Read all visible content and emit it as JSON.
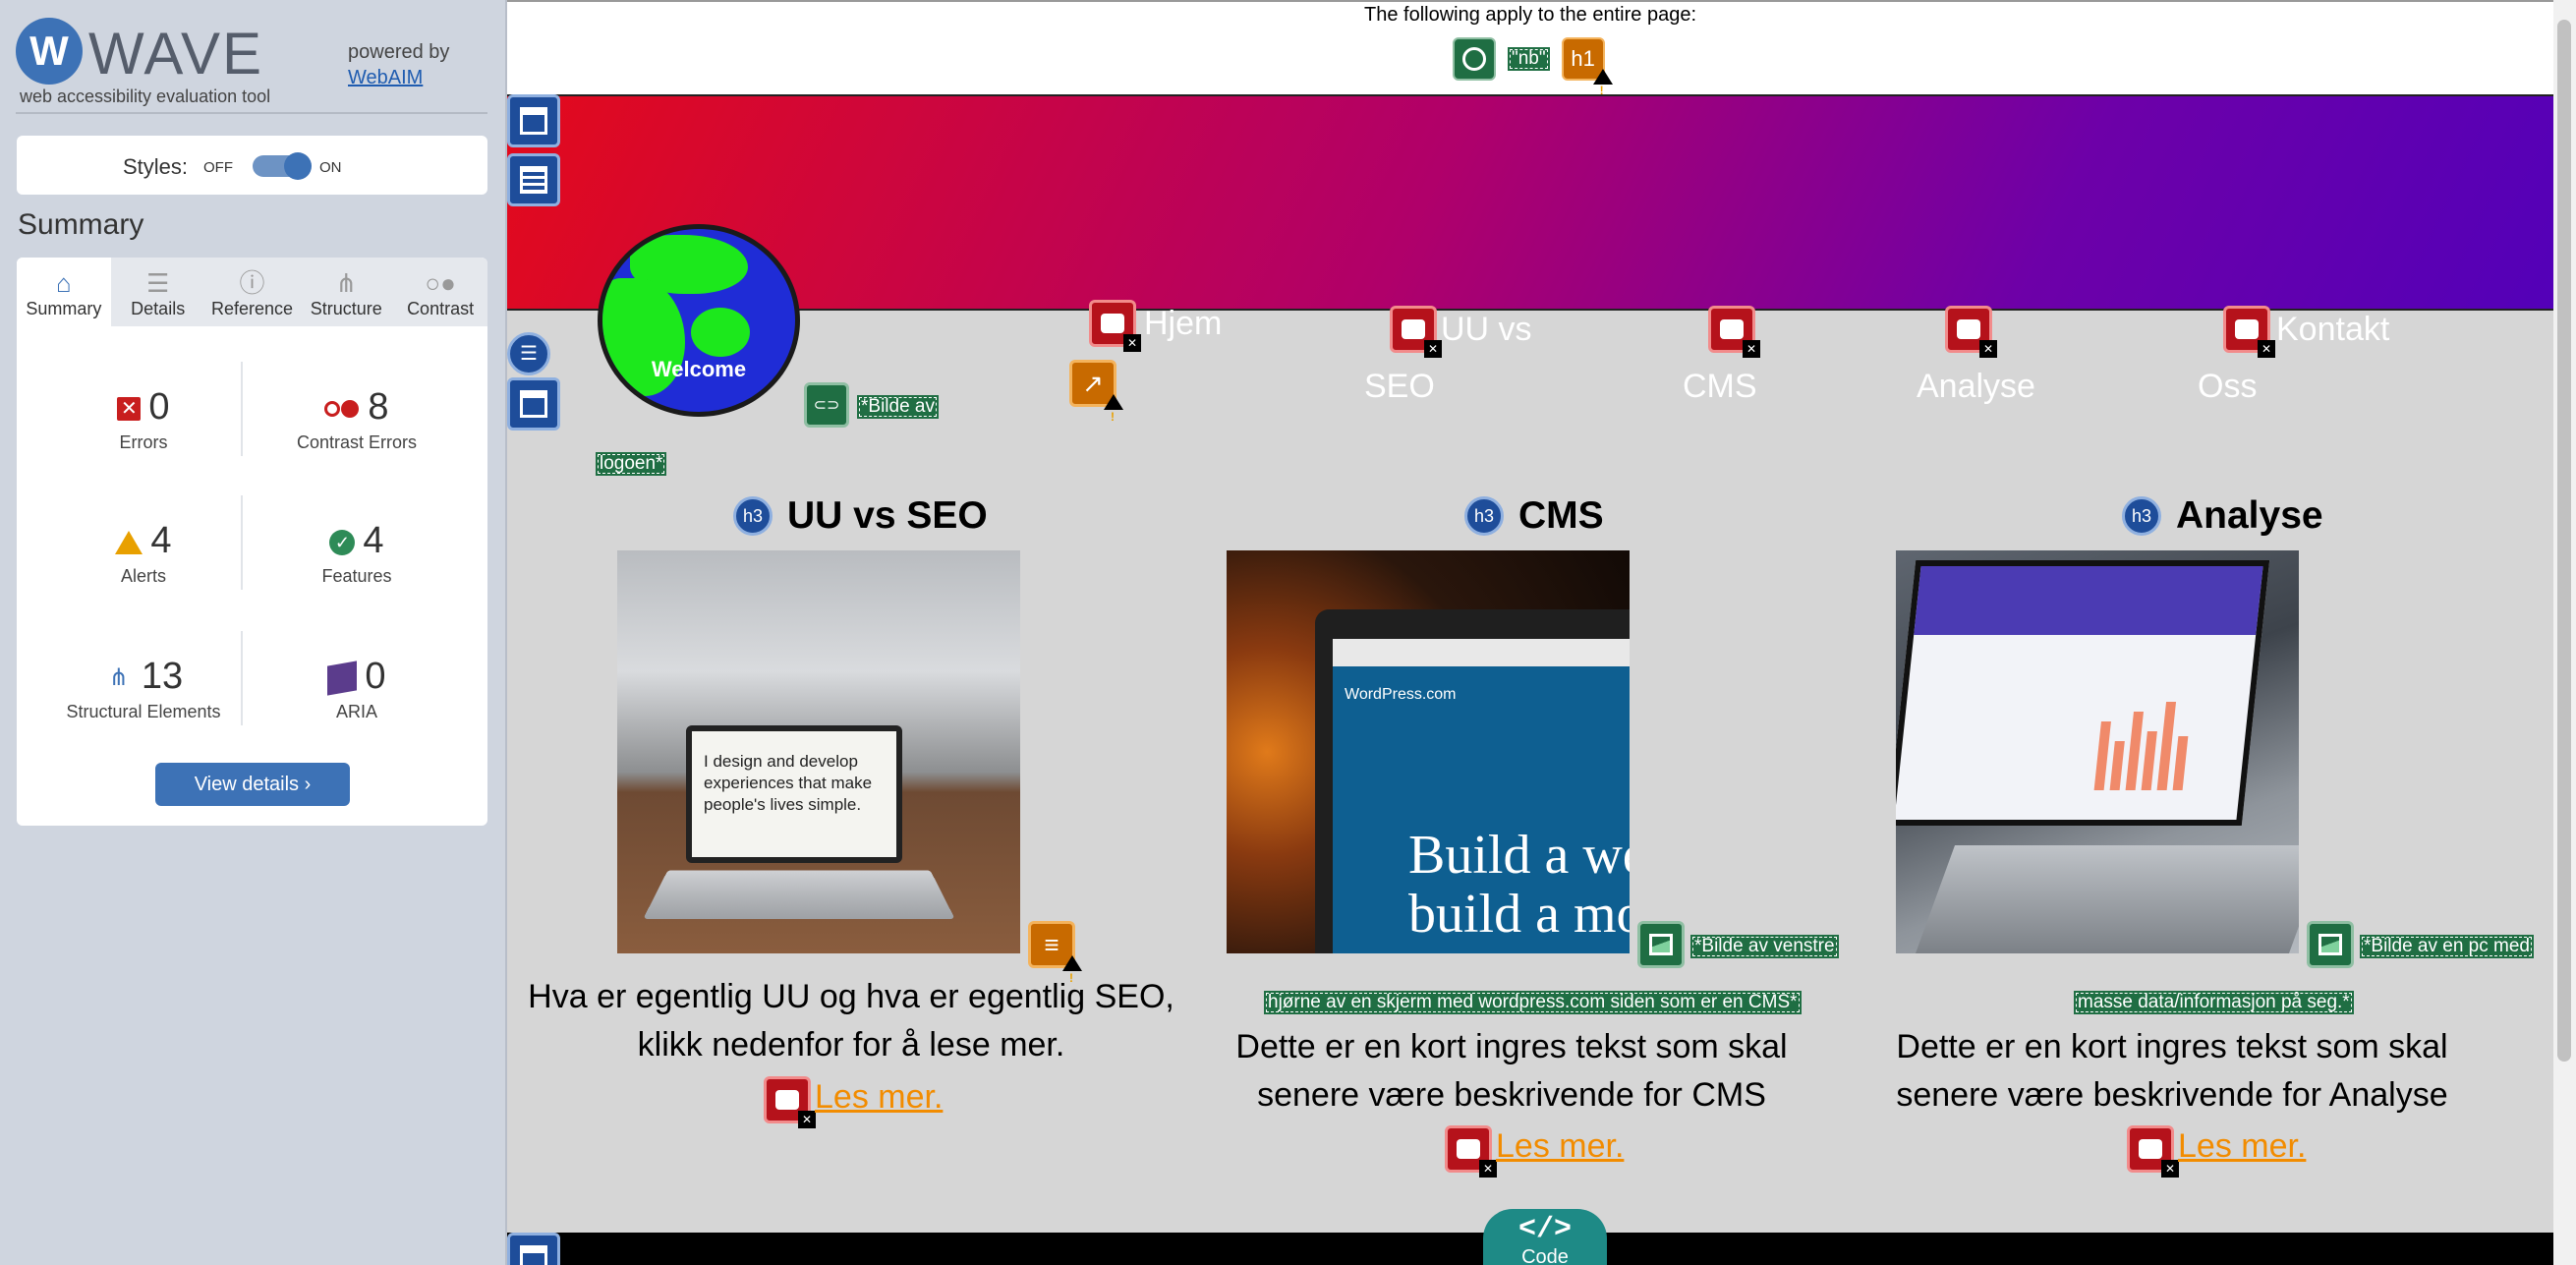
{
  "sidebar": {
    "logo_text": "WAVE",
    "tagline": "web accessibility evaluation tool",
    "powered_by": "powered by",
    "webaim_link": "WebAIM",
    "styles_label": "Styles:",
    "styles_off": "OFF",
    "styles_on": "ON",
    "styles_enabled": true,
    "summary_heading": "Summary",
    "tabs": [
      {
        "label": "Summary",
        "icon": "home-icon",
        "active": true
      },
      {
        "label": "Details",
        "icon": "list-icon",
        "active": false
      },
      {
        "label": "Reference",
        "icon": "info-icon",
        "active": false
      },
      {
        "label": "Structure",
        "icon": "hierarchy-icon",
        "active": false
      },
      {
        "label": "Contrast",
        "icon": "contrast-icon",
        "active": false
      }
    ],
    "stats": {
      "errors": {
        "count": "0",
        "label": "Errors"
      },
      "contrast_errors": {
        "count": "8",
        "label": "Contrast Errors"
      },
      "alerts": {
        "count": "4",
        "label": "Alerts"
      },
      "features": {
        "count": "4",
        "label": "Features"
      },
      "structural": {
        "count": "13",
        "label": "Structural Elements"
      },
      "aria": {
        "count": "0",
        "label": "ARIA"
      }
    },
    "view_details": "View details ›"
  },
  "page": {
    "applies_text": "The following apply to the entire page:",
    "lang_label": "\"nb\"",
    "h1_label": "h1",
    "logo_alt_1": "*Bilde av",
    "logo_alt_2": "logoen*",
    "globe_text": "Welcome",
    "nav": [
      {
        "line1": "Hjem",
        "line2": ""
      },
      {
        "line1": "UU vs",
        "line2": "SEO"
      },
      {
        "line1": "",
        "line2": "CMS"
      },
      {
        "line1": "",
        "line2": "Analyse"
      },
      {
        "line1": "Kontakt",
        "line2": "Oss"
      }
    ],
    "cards": [
      {
        "heading_icon": "h3",
        "title": "UU vs SEO",
        "text_1": "Hva er egentlig UU og hva er egentlig SEO,",
        "text_2": "klikk nedenfor for å lese mer.",
        "link": "Les mer.",
        "screen_text_1": "I design and develop",
        "screen_text_2": "experiences that make",
        "screen_text_3": "people's lives simple."
      },
      {
        "heading_icon": "h3",
        "title": "CMS",
        "alt_1": "*Bilde av venstre",
        "alt_2": "hjørne av en skjerm med wordpress.com siden som er en CMS*",
        "text_1": "Dette er en kort ingres tekst som skal",
        "text_2": "senere være beskrivende for CMS",
        "link": "Les mer.",
        "screen_brand": "WordPress.com",
        "screen_big_1": "Build a webs",
        "screen_big_2": "build a move"
      },
      {
        "heading_icon": "h3",
        "title": "Analyse",
        "alt_1": "*Bilde av en pc med",
        "alt_2": "masse data/informasjon på seg.*",
        "text_1": "Dette er en kort ingres tekst som skal",
        "text_2": "senere være beskrivende for Analyse",
        "link": "Les mer."
      }
    ],
    "code_tab_glyph": "</>",
    "code_tab_label": "Code"
  },
  "colors": {
    "wave_blue": "#3d72b6",
    "error_red": "#b5121b",
    "feature_green": "#1f6e43",
    "alert_orange": "#c86a00",
    "link_orange": "#f28c00",
    "hero_start": "#e30a1b",
    "hero_end": "#5300b8",
    "code_tab": "#1e8a86"
  }
}
